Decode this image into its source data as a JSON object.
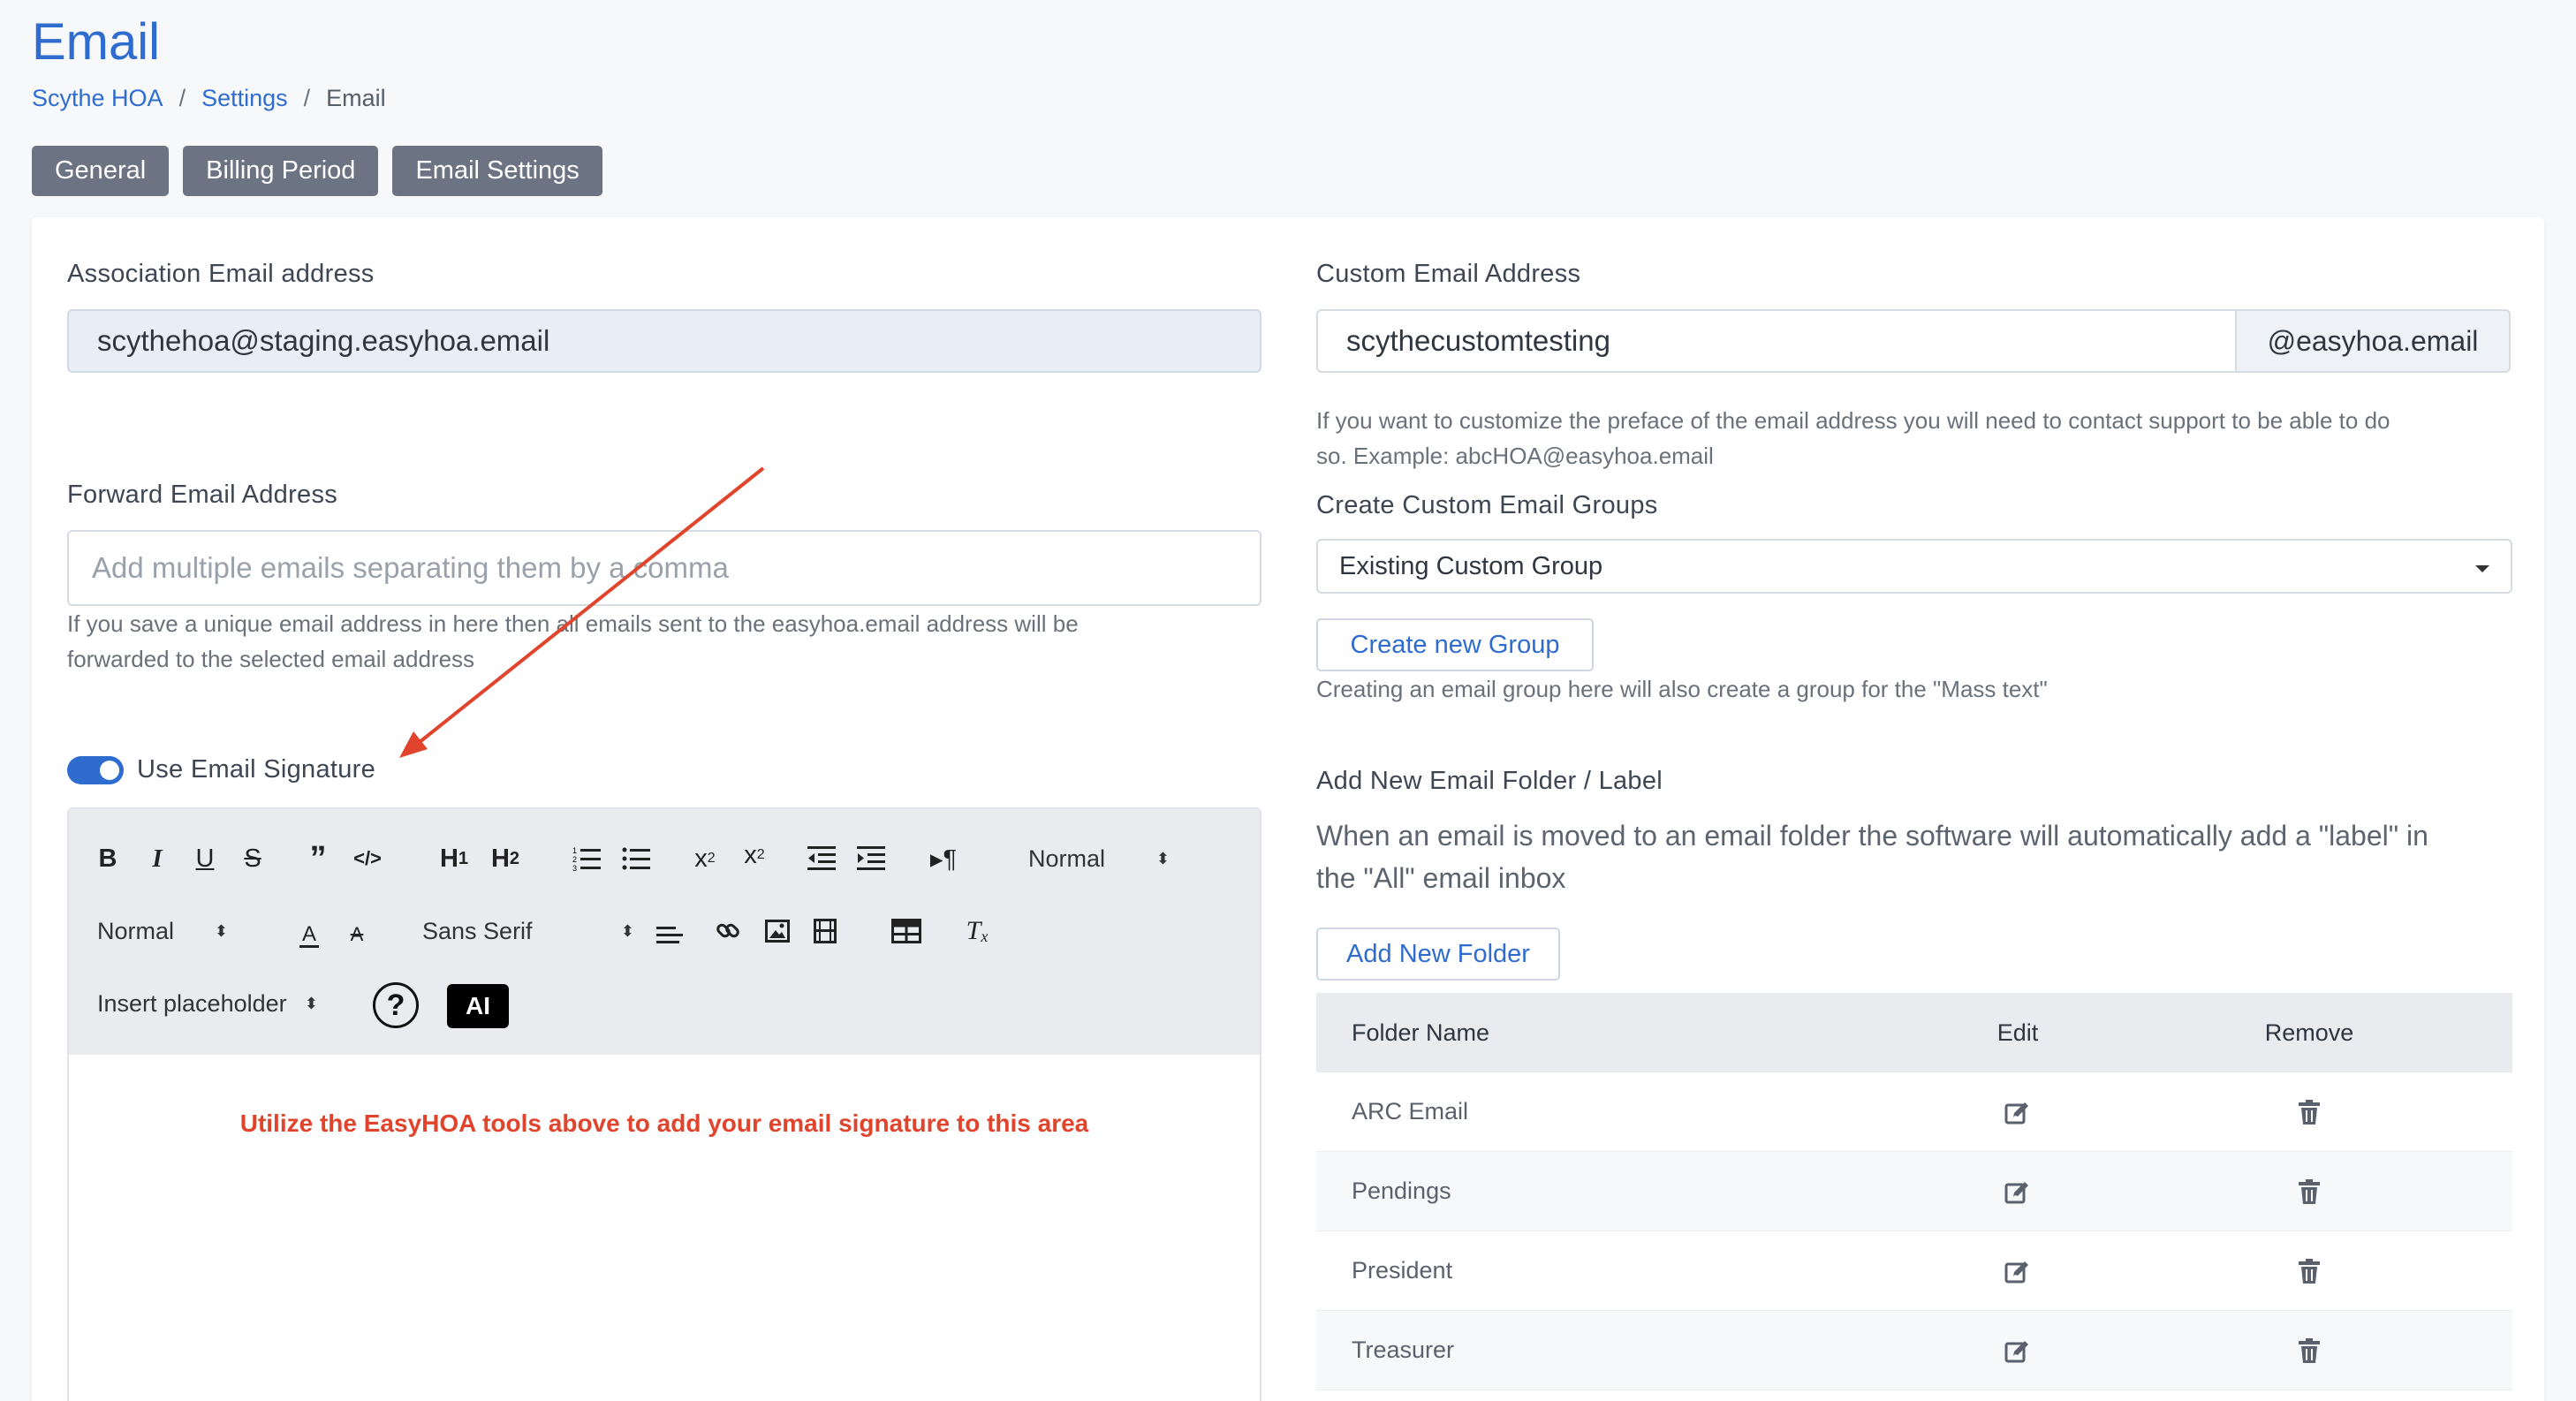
{
  "page": {
    "title": "Email"
  },
  "breadcrumb": {
    "items": [
      "Scythe HOA",
      "Settings",
      "Email"
    ],
    "separator": "/"
  },
  "tabs": [
    "General",
    "Billing Period",
    "Email Settings"
  ],
  "left": {
    "association_label": "Association Email address",
    "association_value": "scythehoa@staging.easyhoa.email",
    "forward_label": "Forward Email Address",
    "forward_placeholder": "Add multiple emails separating them by a comma",
    "forward_help_1": "If you save a unique email address in here then all emails sent to the easyhoa.email address will be",
    "forward_help_2": "forwarded to the selected email address",
    "signature_toggle_label": "Use Email Signature",
    "signature_toggle_on": true,
    "editor": {
      "header_select": "Normal",
      "size_select": "Normal",
      "font_select": "Sans Serif",
      "placeholder_select": "Insert placeholder",
      "ai_label": "AI",
      "help_label": "?",
      "hint": "Utilize the EasyHOA tools above to add your email signature to this area"
    }
  },
  "right": {
    "custom_label": "Custom Email Address",
    "custom_value": "scythecustomtesting",
    "custom_suffix": "@easyhoa.email",
    "custom_help_1": "If you want to customize the preface of the email address you will need to contact support to be able to do",
    "custom_help_2": "so. Example: abcHOA@easyhoa.email",
    "groups_label": "Create Custom Email Groups",
    "groups_select": "Existing Custom Group",
    "create_group_button": "Create new Group",
    "groups_help": "Creating an email group here will also create a group for the \"Mass text\"",
    "folder_label": "Add New Email Folder / Label",
    "folder_desc_1": "When an email is moved to an email folder the software will automatically add a \"label\" in",
    "folder_desc_2": "the \"All\" email inbox",
    "add_folder_button": "Add New Folder",
    "table": {
      "headers": [
        "Folder Name",
        "Edit",
        "Remove"
      ],
      "rows": [
        "ARC Email",
        "Pendings",
        "President",
        "Treasurer"
      ]
    }
  },
  "colors": {
    "accent": "#2f6ccf",
    "annotation": "#e0442c",
    "tab": "#6c7383"
  }
}
